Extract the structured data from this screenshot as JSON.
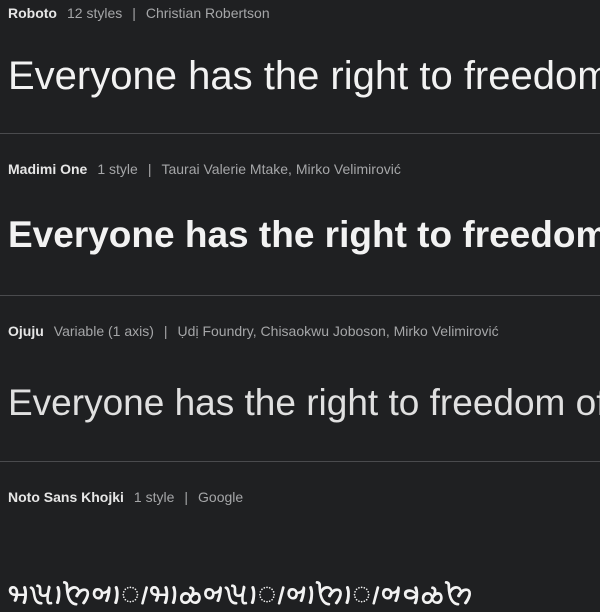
{
  "fonts": [
    {
      "name": "Roboto",
      "styles": "12 styles",
      "designers": "Christian Robertson",
      "sample": "Everyone has the right to freedom of thought"
    },
    {
      "name": "Madimi One",
      "styles": "1 style",
      "designers": "Taurai Valerie Mtake, Mirko Velimirović",
      "sample": "Everyone has the right to freedom of thought"
    },
    {
      "name": "Ojuju",
      "styles": "Variable (1 axis)",
      "designers": "Ụdị Foundry, Chisaokwu Joboson, Mirko Velimirović",
      "sample": "Everyone has the right to freedom of thought"
    },
    {
      "name": "Noto Sans Khojki",
      "styles": "1 style",
      "designers": "Google",
      "sample": "𑈢𑈩𑈬𑈘𑈞𑈬𑈵𑈢𑈬𑈫𑈞𑈩𑈬𑈵𑈞𑈬𑈘𑈬𑈵𑈞𑈨𑈫𑈘"
    }
  ],
  "separator": "|"
}
